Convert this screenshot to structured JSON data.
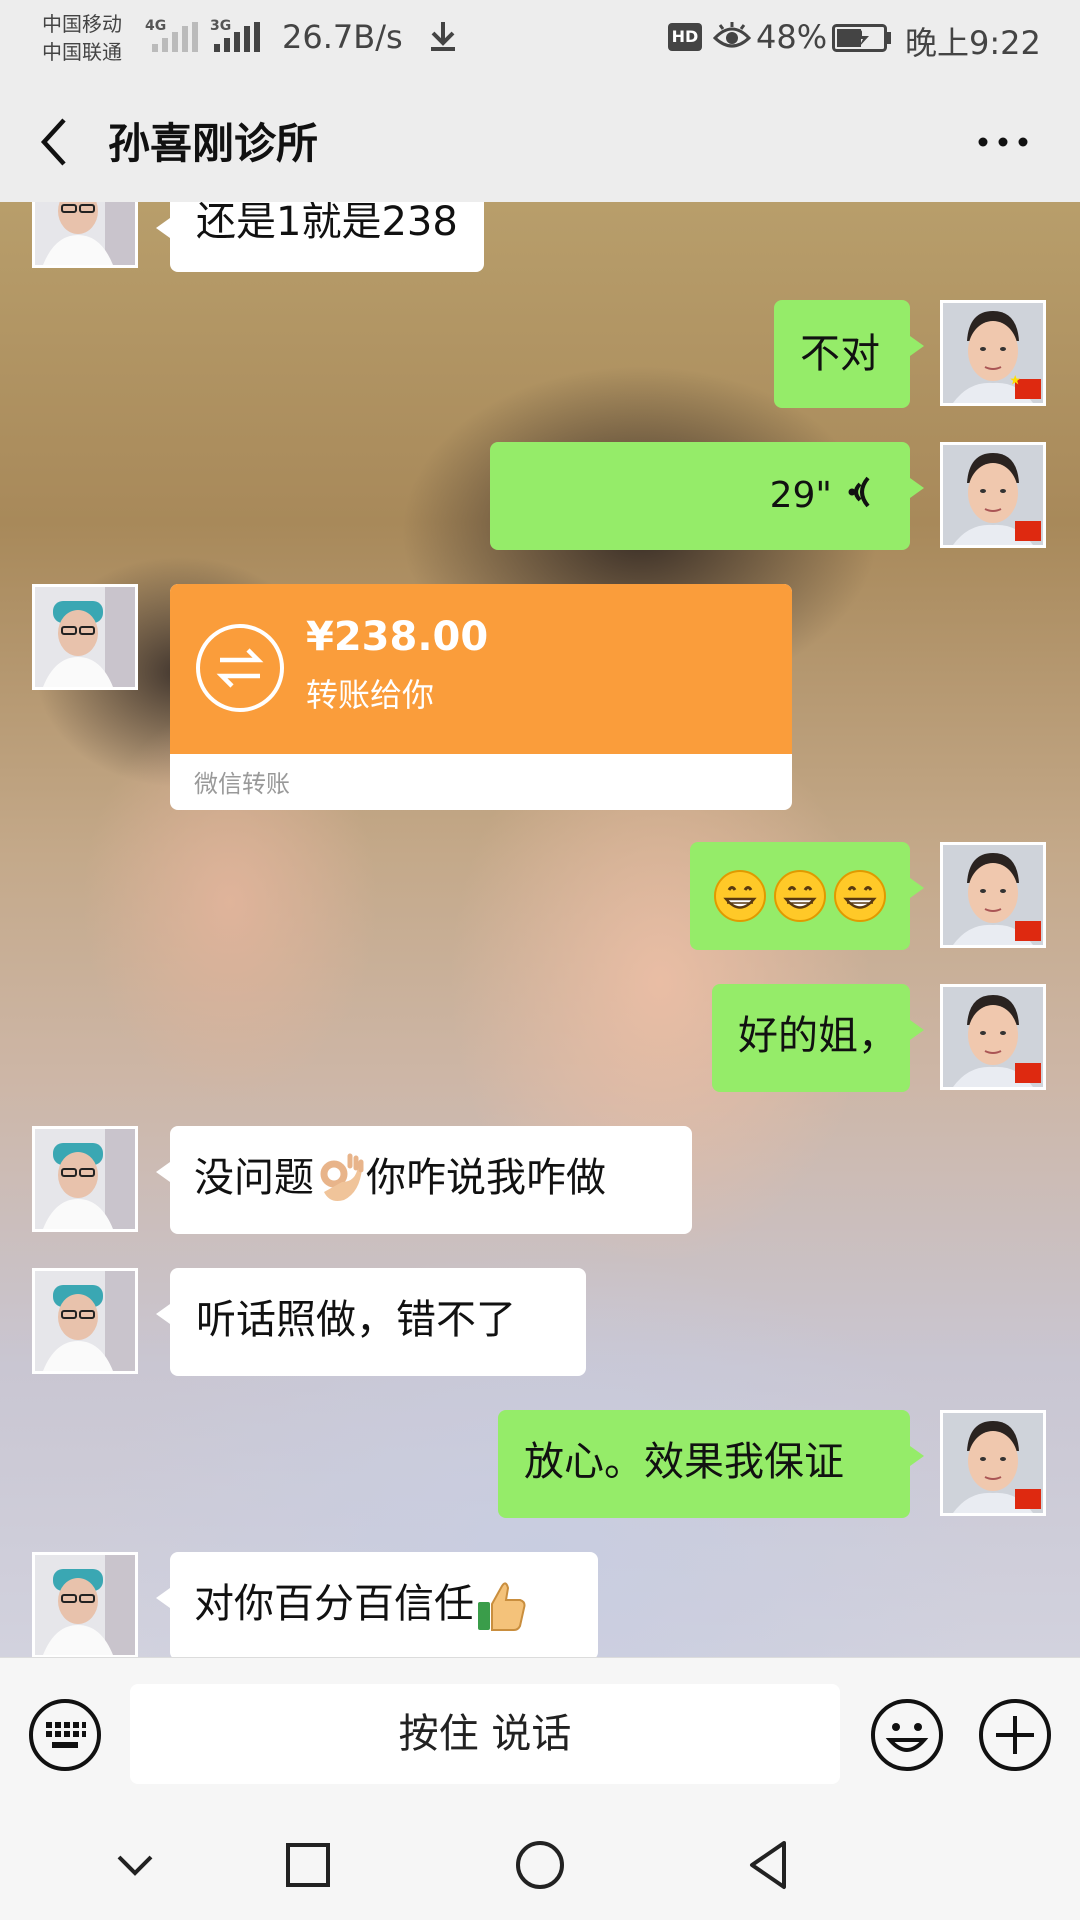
{
  "status_bar": {
    "carrier_1": "中国移动",
    "carrier_2": "中国联通",
    "signal_1_type": "4G",
    "signal_2_type": "3G",
    "net_speed": "26.7B/s",
    "hd_label": "HD",
    "battery_percent": "48%",
    "time": "晚上9:22"
  },
  "header": {
    "title": "孙喜刚诊所"
  },
  "messages": [
    {
      "side": "in",
      "type": "text",
      "text": "还是1就是238"
    },
    {
      "side": "out",
      "type": "text",
      "text": "不对"
    },
    {
      "side": "out",
      "type": "voice",
      "duration": "29\""
    },
    {
      "side": "in",
      "type": "transfer",
      "amount": "¥238.00",
      "desc": "转账给你",
      "footer": "微信转账"
    },
    {
      "side": "out",
      "type": "emoji",
      "emojis": [
        "grin-emoji",
        "grin-emoji",
        "grin-emoji"
      ]
    },
    {
      "side": "out",
      "type": "text",
      "text": "好的姐，"
    },
    {
      "side": "in",
      "type": "text",
      "text_before": "没问题",
      "emoji": "ok-hand-emoji",
      "text_after": "你咋说我咋做"
    },
    {
      "side": "in",
      "type": "text",
      "text": "听话照做，错不了"
    },
    {
      "side": "out",
      "type": "text",
      "text": "放心。效果我保证"
    },
    {
      "side": "in",
      "type": "text",
      "text_before": "对你百分百信任",
      "emoji": "thumbs-up-emoji"
    }
  ],
  "input_bar": {
    "hold_to_talk": "按住 说话"
  },
  "colors": {
    "outgoing_bubble": "#95ec69",
    "incoming_bubble": "#ffffff",
    "transfer_card": "#fa9d3b",
    "bar_background": "#ededed"
  }
}
